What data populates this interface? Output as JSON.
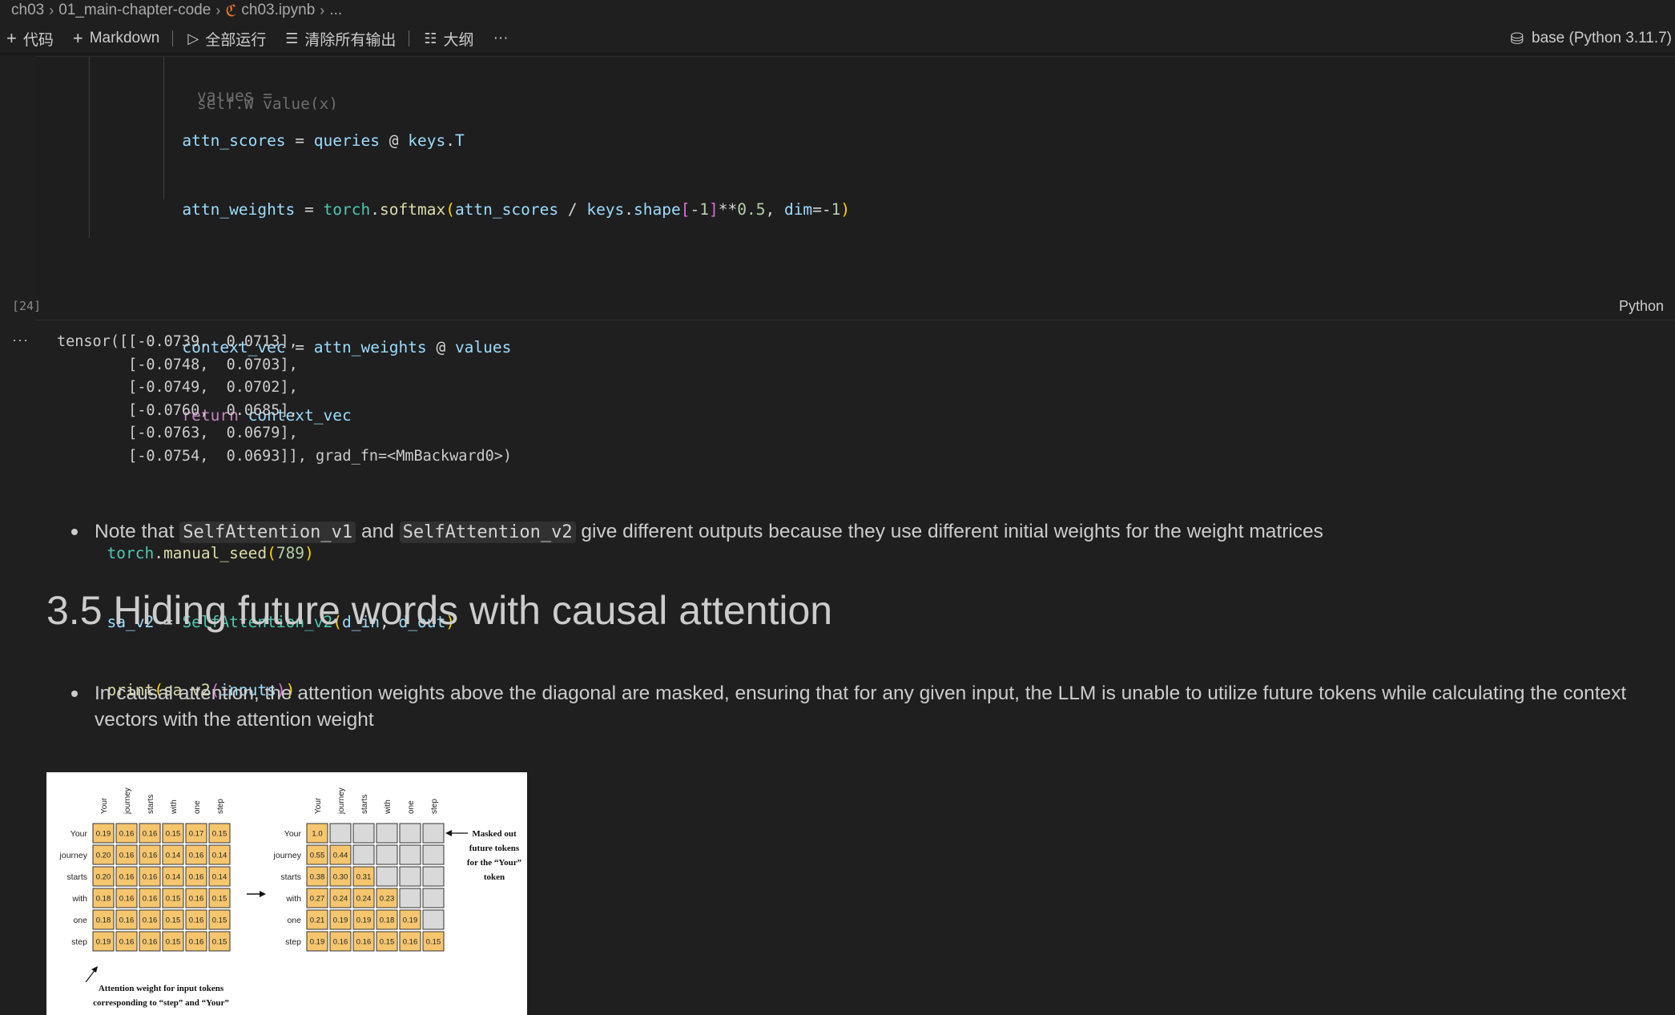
{
  "breadcrumb": {
    "items": [
      "ch03",
      "01_main-chapter-code",
      "ch03.ipynb",
      "..."
    ]
  },
  "toolbar": {
    "add_code": "代码",
    "add_markdown": "Markdown",
    "run_all": "全部运行",
    "clear_outputs": "清除所有输出",
    "outline": "大纲",
    "more": "···",
    "kernel": "base (Python 3.11.7)"
  },
  "cell": {
    "execution_count": "[24]",
    "language": "Python",
    "faded_line": "values = self.W_value(x)",
    "output_dots": "···",
    "output_lines": [
      "tensor([[-0.0739,  0.0713],",
      "        [-0.0748,  0.0703],",
      "        [-0.0749,  0.0702],",
      "        [-0.0760,  0.0685],",
      "        [-0.0763,  0.0679],",
      "        [-0.0754,  0.0693]], grad_fn=<MmBackward0>)"
    ]
  },
  "markdown": {
    "note_before": "Note that ",
    "note_code1": "SelfAttention_v1",
    "note_mid": " and ",
    "note_code2": "SelfAttention_v2",
    "note_after": " give different outputs because they use different initial weights for the weight matrices",
    "heading": "3.5 Hiding future words with causal attention",
    "causal_line1": "In causal attention, the attention weights above the diagonal are masked, ensuring that for any given input, the LLM is unable to utilize future tokens while calculating the context",
    "causal_line2": "vectors with the attention weight"
  },
  "figure": {
    "tokens": [
      "Your",
      "journey",
      "starts",
      "with",
      "one",
      "step"
    ],
    "left_matrix": [
      [
        "0.19",
        "0.16",
        "0.16",
        "0.15",
        "0.17",
        "0.15"
      ],
      [
        "0.20",
        "0.16",
        "0.16",
        "0.14",
        "0.16",
        "0.14"
      ],
      [
        "0.20",
        "0.16",
        "0.16",
        "0.14",
        "0.16",
        "0.14"
      ],
      [
        "0.18",
        "0.16",
        "0.16",
        "0.15",
        "0.16",
        "0.15"
      ],
      [
        "0.18",
        "0.16",
        "0.16",
        "0.15",
        "0.16",
        "0.15"
      ],
      [
        "0.19",
        "0.16",
        "0.16",
        "0.15",
        "0.16",
        "0.15"
      ]
    ],
    "right_matrix": [
      [
        "1.0"
      ],
      [
        "0.55",
        "0.44"
      ],
      [
        "0.38",
        "0.30",
        "0.31"
      ],
      [
        "0.27",
        "0.24",
        "0.24",
        "0.23"
      ],
      [
        "0.21",
        "0.19",
        "0.19",
        "0.18",
        "0.19"
      ],
      [
        "0.19",
        "0.16",
        "0.16",
        "0.15",
        "0.16",
        "0.15"
      ]
    ],
    "masked_note": [
      "Masked out",
      "future tokens",
      "for the “Your”",
      "token"
    ],
    "attention_note": [
      "Attention weight for input tokens",
      "corresponding to “step” and “Your”"
    ],
    "cell_color": "#f5c66e",
    "masked_color": "#d9d9d9"
  }
}
